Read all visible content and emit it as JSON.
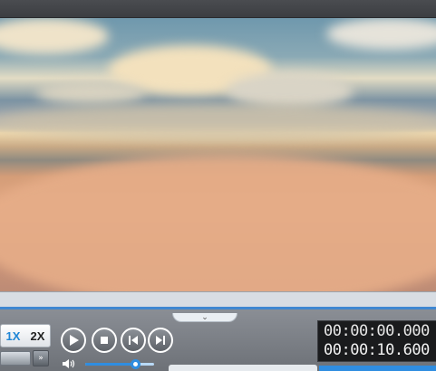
{
  "video": {
    "description_colors": {
      "sky": "#6f98ad",
      "clouds": "#e3a884"
    }
  },
  "speed": {
    "option_1x": "1X",
    "option_2x": "2X",
    "selected": "1X"
  },
  "playback": {
    "play_icon": "play-icon",
    "stop_icon": "stop-icon",
    "prev_icon": "previous-icon",
    "next_icon": "next-icon",
    "ff_icon": "fast-forward-icon"
  },
  "volume": {
    "level": 0.72,
    "icon": "speaker-icon"
  },
  "time": {
    "current": "00:00:00.000",
    "total": "00:00:10.600"
  },
  "colors": {
    "accent": "#2f8de0",
    "seek": "#3f87d1"
  },
  "handle": {
    "glyph": "⌄"
  },
  "fastforward": {
    "glyph": "»"
  }
}
